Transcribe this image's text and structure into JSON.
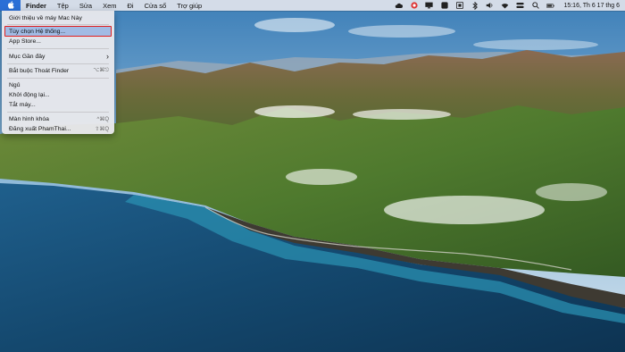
{
  "menubar": {
    "app_name": "Finder",
    "menus": [
      "Tệp",
      "Sửa",
      "Xem",
      "Đi",
      "Cửa sổ",
      "Trợ giúp"
    ],
    "clock": "15:16, Th 6 17 thg 6",
    "icons": [
      "apple-icon",
      "cloud-icon",
      "record-icon",
      "monitor-icon",
      "square-icon",
      "stop-icon",
      "bluetooth-icon",
      "volume-icon",
      "wifi-icon",
      "control-center-icon",
      "search-icon",
      "battery-icon"
    ]
  },
  "apple_menu": {
    "items": [
      {
        "label": "Giới thiệu về máy Mac Này",
        "shortcut": ""
      },
      {
        "label": "Tùy chọn Hệ thống...",
        "shortcut": ""
      },
      {
        "label": "App Store...",
        "shortcut": ""
      },
      {
        "label": "Mục Gần đây",
        "shortcut": "›"
      },
      {
        "label": "Bắt buộc Thoát Finder",
        "shortcut": "⌥⌘⎋"
      },
      {
        "label": "Ngủ",
        "shortcut": ""
      },
      {
        "label": "Khởi động lại...",
        "shortcut": ""
      },
      {
        "label": "Tắt máy...",
        "shortcut": ""
      },
      {
        "label": "Màn hình khóa",
        "shortcut": "^⌘Q"
      },
      {
        "label": "Đăng xuất PhamThai...",
        "shortcut": "⇧⌘Q"
      }
    ],
    "highlighted_item": "Tùy chọn Hệ thống...",
    "highlight_color": "#e02020"
  },
  "wallpaper": "macOS Big Sur coastline"
}
